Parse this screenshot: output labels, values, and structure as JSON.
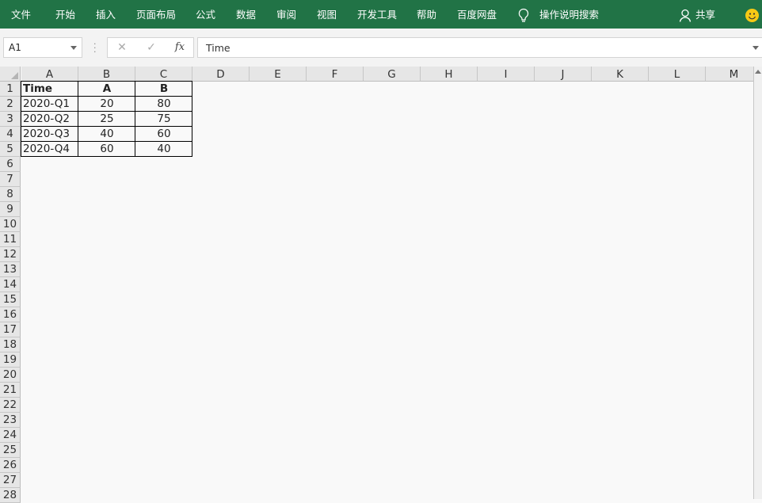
{
  "ribbon": {
    "tabs": [
      "文件",
      "开始",
      "插入",
      "页面布局",
      "公式",
      "数据",
      "审阅",
      "视图",
      "开发工具",
      "帮助",
      "百度网盘"
    ],
    "tell_me": "操作说明搜索",
    "share": "共享",
    "bg_color": "#217346"
  },
  "formula_bar": {
    "name_box": "A1",
    "cancel_icon": "✕",
    "enter_icon": "✓",
    "fx_label": "fx",
    "formula": "Time"
  },
  "sheet": {
    "columns": [
      "A",
      "B",
      "C",
      "D",
      "E",
      "F",
      "G",
      "H",
      "I",
      "J",
      "K",
      "L",
      "M"
    ],
    "rows": [
      "1",
      "2",
      "3",
      "4",
      "5",
      "6",
      "7",
      "8",
      "9",
      "10",
      "11",
      "12",
      "13",
      "14",
      "15",
      "16",
      "17",
      "18",
      "19",
      "20",
      "21",
      "22",
      "23",
      "24",
      "25",
      "26",
      "27",
      "28"
    ],
    "table": {
      "header": [
        "Time",
        "A",
        "B"
      ],
      "data": [
        [
          "2020-Q1",
          "20",
          "80"
        ],
        [
          "2020-Q2",
          "25",
          "75"
        ],
        [
          "2020-Q3",
          "40",
          "60"
        ],
        [
          "2020-Q4",
          "60",
          "40"
        ]
      ]
    }
  }
}
